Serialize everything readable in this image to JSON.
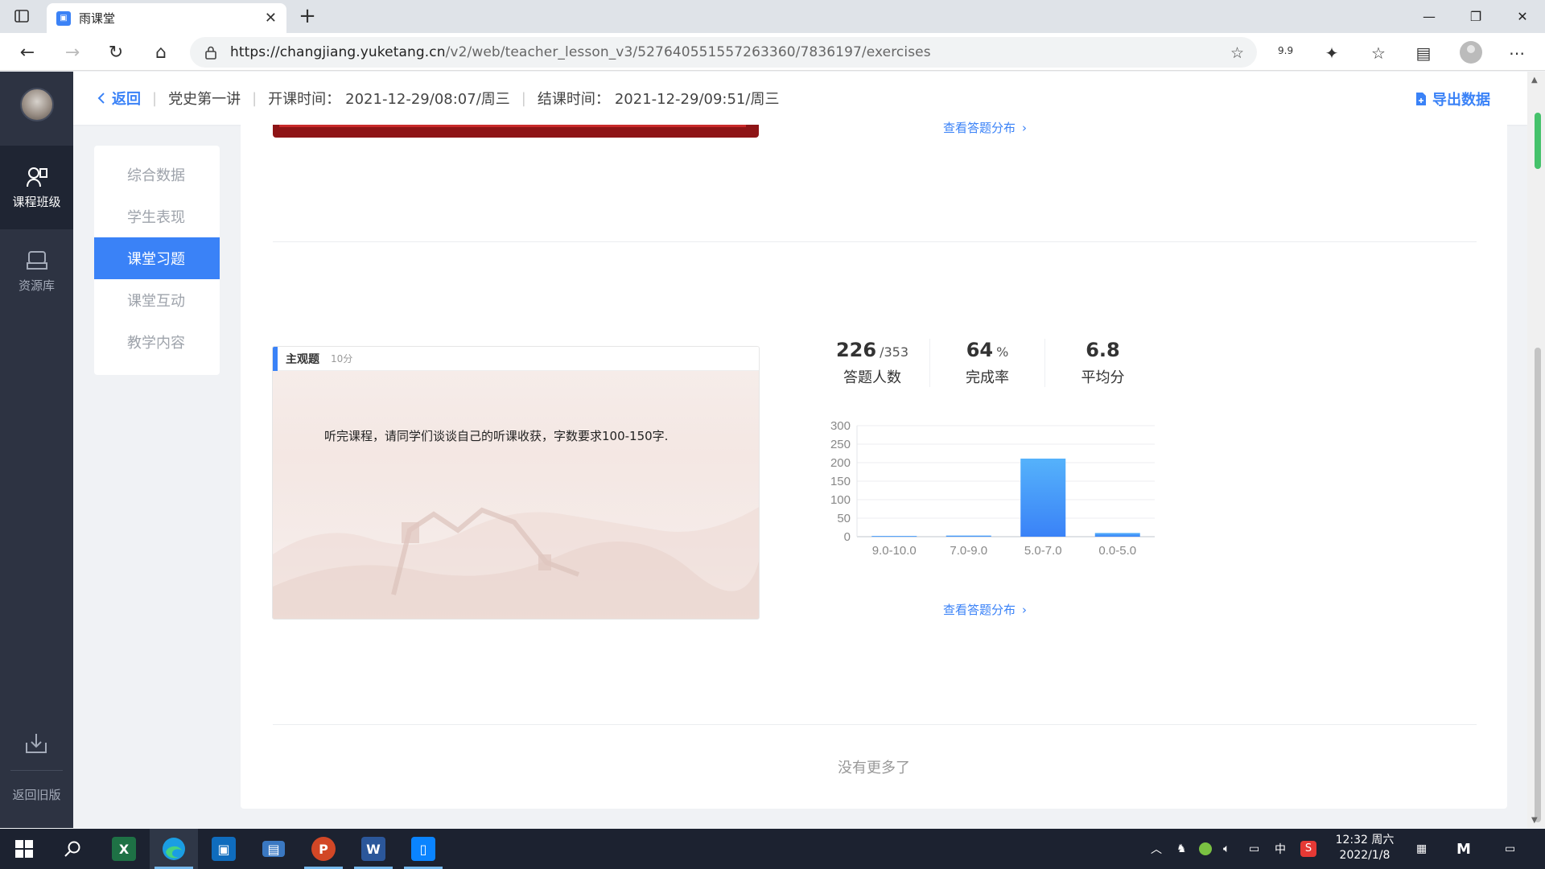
{
  "browser": {
    "tab_title": "雨课堂",
    "url_host": "https://changjiang.yuketang.cn",
    "url_path": "/v2/web/teacher_lesson_v3/527640551557263360/7836197/exercises",
    "zoom_indicator": "9.9"
  },
  "header": {
    "back_label": "返回",
    "lesson_title": "党史第一讲",
    "start_label": "开课时间：",
    "start_time": "2021-12-29/08:07/周三",
    "end_label": "结课时间：",
    "end_time": "2021-12-29/09:51/周三",
    "export_label": "导出数据"
  },
  "app_sidebar": {
    "items": [
      {
        "label": "课程班级",
        "icon": "class-icon"
      },
      {
        "label": "资源库",
        "icon": "library-icon"
      }
    ],
    "bottom_label": "返回旧版"
  },
  "menu": {
    "items": [
      {
        "label": "综合数据",
        "active": false
      },
      {
        "label": "学生表现",
        "active": false
      },
      {
        "label": "课堂习题",
        "active": true
      },
      {
        "label": "课堂互动",
        "active": false
      },
      {
        "label": "教学内容",
        "active": false
      }
    ]
  },
  "exercise_prev": {
    "link_label": "查看答题分布"
  },
  "exercise": {
    "type": "主观题",
    "score": "10分",
    "question": "听完课程，请同学们谈谈自己的听课收获，字数要求100-150字.",
    "stats": {
      "answered": "226",
      "total": "/353",
      "answered_label": "答题人数",
      "completion": "64",
      "completion_unit": "%",
      "completion_label": "完成率",
      "average": "6.8",
      "average_label": "平均分"
    },
    "link_label": "查看答题分布"
  },
  "chart_data": {
    "type": "bar",
    "categories": [
      "9.0-10.0",
      "7.0-9.0",
      "5.0-7.0",
      "0.0-5.0"
    ],
    "values": [
      2,
      3,
      211,
      10
    ],
    "ylim": [
      0,
      300
    ],
    "yticks": [
      0,
      50,
      100,
      150,
      200,
      250,
      300
    ],
    "grid": true,
    "bar_color": "#3a82f7"
  },
  "footer": {
    "no_more": "没有更多了"
  },
  "taskbar": {
    "clock_time": "12:32 周六",
    "clock_date": "2022/1/8",
    "ime": "中"
  }
}
